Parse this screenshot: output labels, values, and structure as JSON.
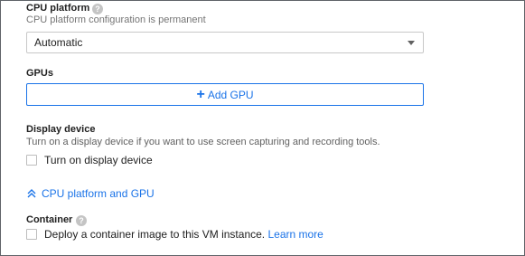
{
  "cpu_platform": {
    "title": "CPU platform",
    "help_icon": "help-icon",
    "subtitle": "CPU platform configuration is permanent",
    "select_value": "Automatic"
  },
  "gpus": {
    "title": "GPUs",
    "add_label": "Add GPU",
    "add_icon": "+"
  },
  "display_device": {
    "title": "Display device",
    "subtitle": "Turn on a display device if you want to use screen capturing and recording tools.",
    "checkbox_label": "Turn on display device",
    "checked": false
  },
  "collapse_link": {
    "label": "CPU platform and GPU",
    "icon": "chevron-double-up-icon"
  },
  "container": {
    "title": "Container",
    "help_icon": "help-icon",
    "checkbox_label": "Deploy a container image to this VM instance.",
    "learn_more": "Learn more",
    "checked": false
  },
  "colors": {
    "accent": "#1a73e8",
    "border": "#c8c8c8",
    "help_gray": "#c4c4c4"
  }
}
